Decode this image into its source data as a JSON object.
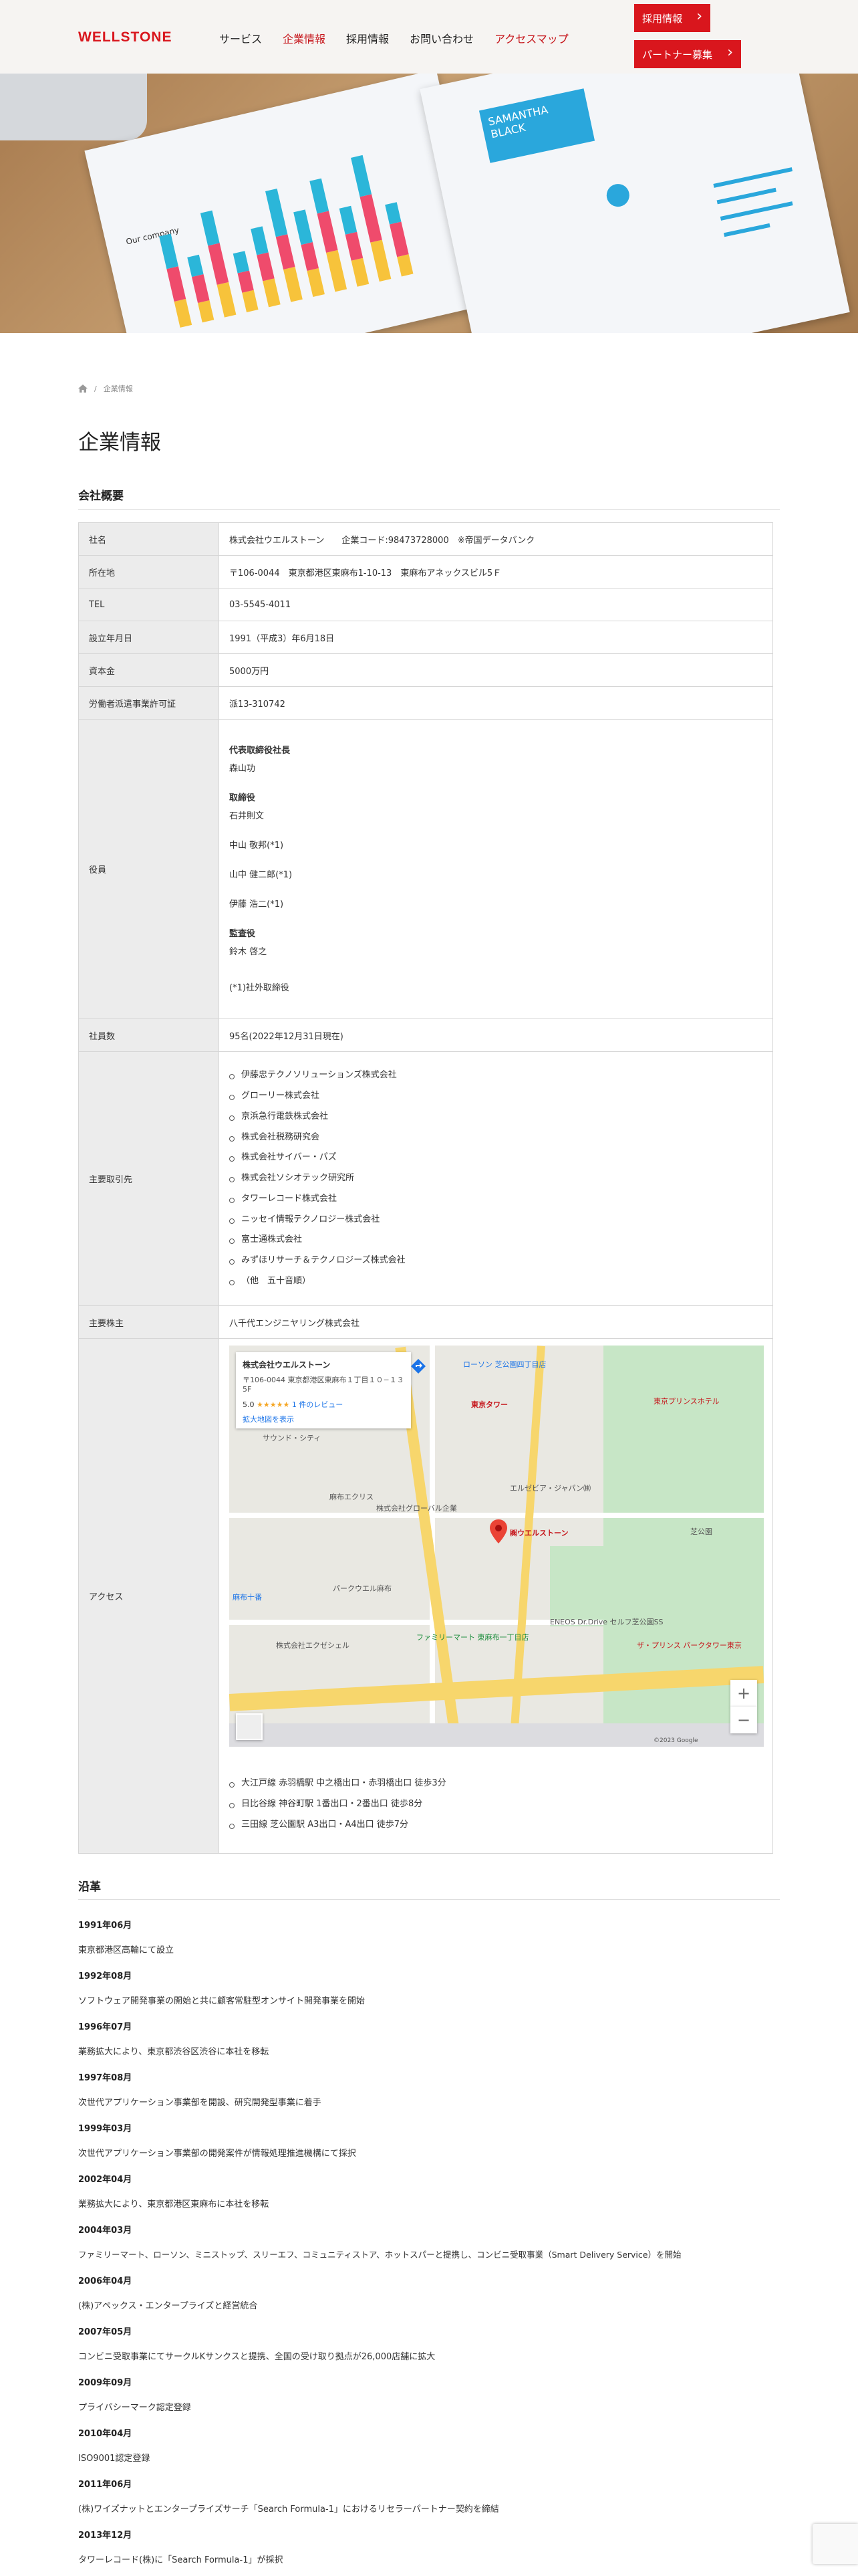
{
  "header": {
    "logo": "WELLSTONE",
    "nav": [
      "サービス",
      "企業情報",
      "採用情報",
      "お問い合わせ",
      "アクセスマップ"
    ],
    "buttons": [
      "採用情報",
      "パートナー募集"
    ]
  },
  "hero": {
    "resume_name": "SAMANTHA BLACK",
    "chart_title": "Our company"
  },
  "breadcrumb": {
    "current": "企業情報"
  },
  "page_title": "企業情報",
  "overview": {
    "title": "会社概要",
    "rows": {
      "name_label": "社名",
      "name_value": "株式会社ウエルストーン　　企業コード:98473728000　※帝国データバンク",
      "address_label": "所在地",
      "address_value": "〒106-0044　東京都港区東麻布1-10-13　東麻布アネックスビル5Ｆ",
      "tel_label": "TEL",
      "tel_value": "03-5545-4011",
      "founded_label": "設立年月日",
      "founded_value": "1991（平成3）年6月18日",
      "capital_label": "資本金",
      "capital_value": "5000万円",
      "license_label": "労働者派遣事業許可証",
      "license_value": "派13-310742",
      "officers_label": "役員",
      "officers": {
        "ceo_title": "代表取締役社長",
        "ceo_name": "森山功",
        "dir_title": "取締役",
        "dir1": "石井則文",
        "dir2": "中山 敬邦(*1)",
        "dir3": "山中 健二郎(*1)",
        "dir4": "伊藤 浩二(*1)",
        "aud_title": "監査役",
        "aud_name": "鈴木 啓之",
        "note": "(*1)社外取締役"
      },
      "employees_label": "社員数",
      "employees_value": "95名(2022年12月31日現在)",
      "clients_label": "主要取引先",
      "clients": [
        "伊藤忠テクノソリューションズ株式会社",
        "グローリー株式会社",
        "京浜急行電鉄株式会社",
        "株式会社税務研究会",
        "株式会社サイバー・パズ",
        "株式会社ソシオテック研究所",
        "タワーレコード株式会社",
        "ニッセイ情報テクノロジー株式会社",
        "富士通株式会社",
        "みずほリサーチ＆テクノロジーズ株式会社",
        "（他　五十音順）"
      ],
      "shareholder_label": "主要株主",
      "shareholder_value": "八千代エンジニヤリング株式会社",
      "access_label": "アクセス",
      "access": [
        "大江戸線 赤羽橋駅 中之橋出口・赤羽橋出口 徒歩3分",
        "日比谷線 神谷町駅 1番出口・2番出口 徒歩8分",
        "三田線 芝公園駅 A3出口・A4出口 徒歩7分"
      ]
    }
  },
  "map": {
    "card_name": "株式会社ウエルストーン",
    "card_addr": "〒106-0044 東京都港区東麻布１丁目１０−１３ 5F",
    "rating": "5.0",
    "stars": "★★★★★",
    "reviews": "1 件のレビュー",
    "big_map": "拡大地図を表示",
    "pin_label": "㈱ウエルストーン",
    "labels": [
      "東京タワー",
      "ローソン 芝公園四丁目店",
      "東京プリンスホテル",
      "ザ・プリンス パークタワー東京",
      "麻布エクリス",
      "株式会社グローバル企業",
      "パークウエル麻布",
      "株式会社エクゼシェル",
      "エルゼビア・ジャパン㈱",
      "ファミリーマート 東麻布一丁目店",
      "サウンド・シティ",
      "ENEOS Dr.Drive セルフ芝公園SS",
      "芝公園",
      "麻布十番"
    ],
    "copyright": "©2023 Google",
    "zoom_in": "+",
    "zoom_out": "−"
  },
  "history": {
    "title": "沿革",
    "items": [
      {
        "date": "1991年06月",
        "text": "東京都港区高輪にて設立"
      },
      {
        "date": "1992年08月",
        "text": "ソフトウェア開発事業の開始と共に顧客常駐型オンサイト開発事業を開始"
      },
      {
        "date": "1996年07月",
        "text": "業務拡大により、東京都渋谷区渋谷に本社を移転"
      },
      {
        "date": "1997年08月",
        "text": "次世代アプリケーション事業部を開設、研究開発型事業に着手"
      },
      {
        "date": "1999年03月",
        "text": "次世代アプリケーション事業部の開発案件が情報処理推進機構にて採択"
      },
      {
        "date": "2002年04月",
        "text": "業務拡大により、東京都港区東麻布に本社を移転"
      },
      {
        "date": "2004年03月",
        "text": "ファミリーマート、ローソン、ミニストップ、スリーエフ、コミュニティストア、ホットスパーと提携し、コンビニ受取事業（Smart Delivery Service）を開始"
      },
      {
        "date": "2006年04月",
        "text": "(株)アペックス・エンタープライズと経営統合"
      },
      {
        "date": "2007年05月",
        "text": "コンビニ受取事業にてサークルKサンクスと提携、全国の受け取り拠点が26,000店舗に拡大"
      },
      {
        "date": "2009年09月",
        "text": "プライバシーマーク認定登録"
      },
      {
        "date": "2010年04月",
        "text": "ISO9001認定登録"
      },
      {
        "date": "2011年06月",
        "text": "(株)ワイズナットとエンタープライズサーチ「Search Formula-1」におけるリセラーパートナー契約を締結"
      },
      {
        "date": "2013年12月",
        "text": "タワーレコード(株)に「Search Formula-1」が採択"
      }
    ]
  }
}
